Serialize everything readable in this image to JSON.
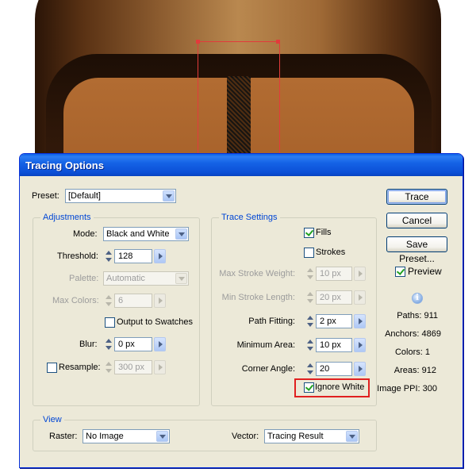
{
  "dialog": {
    "title": "Tracing Options",
    "preset": {
      "label": "Preset:",
      "value": "[Default]"
    },
    "adjustments": {
      "legend": "Adjustments",
      "mode": {
        "label": "Mode:",
        "value": "Black and White"
      },
      "threshold": {
        "label": "Threshold:",
        "value": "128"
      },
      "palette": {
        "label": "Palette:",
        "value": "Automatic",
        "enabled": false
      },
      "max_colors": {
        "label": "Max Colors:",
        "value": "6",
        "enabled": false
      },
      "output_to_swatches": {
        "label": "Output to Swatches",
        "checked": false
      },
      "blur": {
        "label": "Blur:",
        "value": "0 px"
      },
      "resample": {
        "label": "Resample:",
        "value": "300 px",
        "checked": false
      }
    },
    "trace_settings": {
      "legend": "Trace Settings",
      "fills": {
        "label": "Fills",
        "checked": true
      },
      "strokes": {
        "label": "Strokes",
        "checked": false
      },
      "max_stroke_weight": {
        "label": "Max Stroke Weight:",
        "value": "10 px",
        "enabled": false
      },
      "min_stroke_length": {
        "label": "Min Stroke Length:",
        "value": "20 px",
        "enabled": false
      },
      "path_fitting": {
        "label": "Path Fitting:",
        "value": "2 px"
      },
      "minimum_area": {
        "label": "Minimum Area:",
        "value": "10 px"
      },
      "corner_angle": {
        "label": "Corner Angle:",
        "value": "20"
      },
      "ignore_white": {
        "label": "Ignore White",
        "checked": true
      }
    },
    "view": {
      "legend": "View",
      "raster": {
        "label": "Raster:",
        "value": "No Image"
      },
      "vector": {
        "label": "Vector:",
        "value": "Tracing Result"
      }
    },
    "buttons": {
      "trace": "Trace",
      "cancel": "Cancel",
      "save_preset": "Save Preset..."
    },
    "preview": {
      "label": "Preview",
      "checked": true
    },
    "info_icon": "info-icon",
    "stats": {
      "paths": "Paths: 911",
      "anchors": "Anchors: 4869",
      "colors": "Colors: 1",
      "areas": "Areas: 912",
      "image_ppi": "Image PPI: 300"
    }
  },
  "colors": {
    "highlight": "#e02020",
    "title_bar": "#0b4fd6",
    "dialog_bg": "#ece9d8",
    "legend_text": "#0046d5"
  }
}
